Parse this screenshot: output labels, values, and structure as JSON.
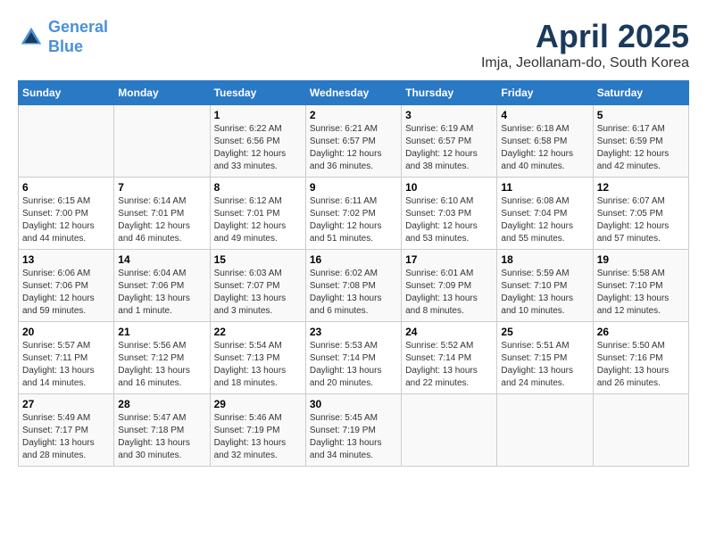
{
  "header": {
    "logo_line1": "General",
    "logo_line2": "Blue",
    "month_year": "April 2025",
    "location": "Imja, Jeollanam-do, South Korea"
  },
  "days_of_week": [
    "Sunday",
    "Monday",
    "Tuesday",
    "Wednesday",
    "Thursday",
    "Friday",
    "Saturday"
  ],
  "weeks": [
    [
      {
        "day": "",
        "sunrise": "",
        "sunset": "",
        "daylight": ""
      },
      {
        "day": "",
        "sunrise": "",
        "sunset": "",
        "daylight": ""
      },
      {
        "day": "1",
        "sunrise": "Sunrise: 6:22 AM",
        "sunset": "Sunset: 6:56 PM",
        "daylight": "Daylight: 12 hours and 33 minutes."
      },
      {
        "day": "2",
        "sunrise": "Sunrise: 6:21 AM",
        "sunset": "Sunset: 6:57 PM",
        "daylight": "Daylight: 12 hours and 36 minutes."
      },
      {
        "day": "3",
        "sunrise": "Sunrise: 6:19 AM",
        "sunset": "Sunset: 6:57 PM",
        "daylight": "Daylight: 12 hours and 38 minutes."
      },
      {
        "day": "4",
        "sunrise": "Sunrise: 6:18 AM",
        "sunset": "Sunset: 6:58 PM",
        "daylight": "Daylight: 12 hours and 40 minutes."
      },
      {
        "day": "5",
        "sunrise": "Sunrise: 6:17 AM",
        "sunset": "Sunset: 6:59 PM",
        "daylight": "Daylight: 12 hours and 42 minutes."
      }
    ],
    [
      {
        "day": "6",
        "sunrise": "Sunrise: 6:15 AM",
        "sunset": "Sunset: 7:00 PM",
        "daylight": "Daylight: 12 hours and 44 minutes."
      },
      {
        "day": "7",
        "sunrise": "Sunrise: 6:14 AM",
        "sunset": "Sunset: 7:01 PM",
        "daylight": "Daylight: 12 hours and 46 minutes."
      },
      {
        "day": "8",
        "sunrise": "Sunrise: 6:12 AM",
        "sunset": "Sunset: 7:01 PM",
        "daylight": "Daylight: 12 hours and 49 minutes."
      },
      {
        "day": "9",
        "sunrise": "Sunrise: 6:11 AM",
        "sunset": "Sunset: 7:02 PM",
        "daylight": "Daylight: 12 hours and 51 minutes."
      },
      {
        "day": "10",
        "sunrise": "Sunrise: 6:10 AM",
        "sunset": "Sunset: 7:03 PM",
        "daylight": "Daylight: 12 hours and 53 minutes."
      },
      {
        "day": "11",
        "sunrise": "Sunrise: 6:08 AM",
        "sunset": "Sunset: 7:04 PM",
        "daylight": "Daylight: 12 hours and 55 minutes."
      },
      {
        "day": "12",
        "sunrise": "Sunrise: 6:07 AM",
        "sunset": "Sunset: 7:05 PM",
        "daylight": "Daylight: 12 hours and 57 minutes."
      }
    ],
    [
      {
        "day": "13",
        "sunrise": "Sunrise: 6:06 AM",
        "sunset": "Sunset: 7:06 PM",
        "daylight": "Daylight: 12 hours and 59 minutes."
      },
      {
        "day": "14",
        "sunrise": "Sunrise: 6:04 AM",
        "sunset": "Sunset: 7:06 PM",
        "daylight": "Daylight: 13 hours and 1 minute."
      },
      {
        "day": "15",
        "sunrise": "Sunrise: 6:03 AM",
        "sunset": "Sunset: 7:07 PM",
        "daylight": "Daylight: 13 hours and 3 minutes."
      },
      {
        "day": "16",
        "sunrise": "Sunrise: 6:02 AM",
        "sunset": "Sunset: 7:08 PM",
        "daylight": "Daylight: 13 hours and 6 minutes."
      },
      {
        "day": "17",
        "sunrise": "Sunrise: 6:01 AM",
        "sunset": "Sunset: 7:09 PM",
        "daylight": "Daylight: 13 hours and 8 minutes."
      },
      {
        "day": "18",
        "sunrise": "Sunrise: 5:59 AM",
        "sunset": "Sunset: 7:10 PM",
        "daylight": "Daylight: 13 hours and 10 minutes."
      },
      {
        "day": "19",
        "sunrise": "Sunrise: 5:58 AM",
        "sunset": "Sunset: 7:10 PM",
        "daylight": "Daylight: 13 hours and 12 minutes."
      }
    ],
    [
      {
        "day": "20",
        "sunrise": "Sunrise: 5:57 AM",
        "sunset": "Sunset: 7:11 PM",
        "daylight": "Daylight: 13 hours and 14 minutes."
      },
      {
        "day": "21",
        "sunrise": "Sunrise: 5:56 AM",
        "sunset": "Sunset: 7:12 PM",
        "daylight": "Daylight: 13 hours and 16 minutes."
      },
      {
        "day": "22",
        "sunrise": "Sunrise: 5:54 AM",
        "sunset": "Sunset: 7:13 PM",
        "daylight": "Daylight: 13 hours and 18 minutes."
      },
      {
        "day": "23",
        "sunrise": "Sunrise: 5:53 AM",
        "sunset": "Sunset: 7:14 PM",
        "daylight": "Daylight: 13 hours and 20 minutes."
      },
      {
        "day": "24",
        "sunrise": "Sunrise: 5:52 AM",
        "sunset": "Sunset: 7:14 PM",
        "daylight": "Daylight: 13 hours and 22 minutes."
      },
      {
        "day": "25",
        "sunrise": "Sunrise: 5:51 AM",
        "sunset": "Sunset: 7:15 PM",
        "daylight": "Daylight: 13 hours and 24 minutes."
      },
      {
        "day": "26",
        "sunrise": "Sunrise: 5:50 AM",
        "sunset": "Sunset: 7:16 PM",
        "daylight": "Daylight: 13 hours and 26 minutes."
      }
    ],
    [
      {
        "day": "27",
        "sunrise": "Sunrise: 5:49 AM",
        "sunset": "Sunset: 7:17 PM",
        "daylight": "Daylight: 13 hours and 28 minutes."
      },
      {
        "day": "28",
        "sunrise": "Sunrise: 5:47 AM",
        "sunset": "Sunset: 7:18 PM",
        "daylight": "Daylight: 13 hours and 30 minutes."
      },
      {
        "day": "29",
        "sunrise": "Sunrise: 5:46 AM",
        "sunset": "Sunset: 7:19 PM",
        "daylight": "Daylight: 13 hours and 32 minutes."
      },
      {
        "day": "30",
        "sunrise": "Sunrise: 5:45 AM",
        "sunset": "Sunset: 7:19 PM",
        "daylight": "Daylight: 13 hours and 34 minutes."
      },
      {
        "day": "",
        "sunrise": "",
        "sunset": "",
        "daylight": ""
      },
      {
        "day": "",
        "sunrise": "",
        "sunset": "",
        "daylight": ""
      },
      {
        "day": "",
        "sunrise": "",
        "sunset": "",
        "daylight": ""
      }
    ]
  ]
}
